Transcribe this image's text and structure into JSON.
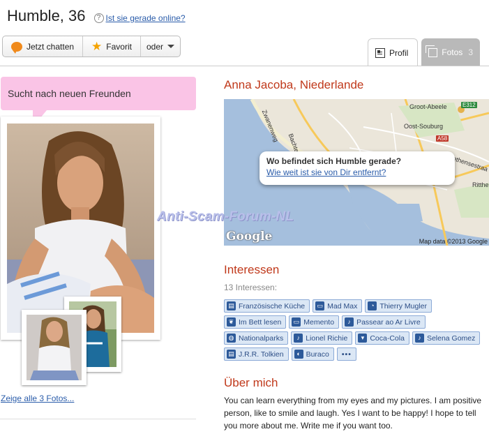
{
  "header": {
    "name_age": "Humble, 36",
    "help_icon": "question-icon",
    "online_link": "Ist sie gerade online?"
  },
  "actions": {
    "chat_label": "Jetzt chatten",
    "favorite_label": "Favorit",
    "more_label": "oder"
  },
  "tabs": [
    {
      "label": "Profil",
      "icon": "profile-doc-icon",
      "active": true
    },
    {
      "label": "Fotos",
      "count": "3",
      "icon": "photos-icon",
      "active": false
    }
  ],
  "status_bubble": "Sucht nach neuen Freunden",
  "show_all_photos": "Zeige alle 3 Fotos...",
  "location": "Anna Jacoba, Niederlande",
  "map": {
    "popup_question": "Wo befindet sich Humble gerade?",
    "popup_link": "Wie weit ist sie von Dir entfernt?",
    "labels": [
      "Groot-Abeele",
      "Oost-Souburg",
      "Ritthe",
      "Zwanenweg",
      "Bachten",
      "ethensestraa"
    ],
    "road_signs": [
      "E312",
      "A58"
    ],
    "logo": "Google",
    "copyright": "Map data ©2013 Google"
  },
  "watermark": "Anti-Scam-Forum-NL",
  "interests": {
    "title": "Interessen",
    "count_text": "13 Interessen:",
    "items": [
      {
        "label": "Französische Küche",
        "icon": "book-icon"
      },
      {
        "label": "Mad Max",
        "icon": "tv-icon"
      },
      {
        "label": "Thierry Mugler",
        "icon": "perfume-icon"
      },
      {
        "label": "Im Bett lesen",
        "icon": "leaf-icon"
      },
      {
        "label": "Memento",
        "icon": "tv-icon"
      },
      {
        "label": "Passear ao Ar Livre",
        "icon": "guitar-icon"
      },
      {
        "label": "Nationalparks",
        "icon": "globe-icon"
      },
      {
        "label": "Lionel Richie",
        "icon": "music-note-icon"
      },
      {
        "label": "Coca-Cola",
        "icon": "cup-icon"
      },
      {
        "label": "Selena Gomez",
        "icon": "music-note-icon"
      },
      {
        "label": "J.R.R. Tolkien",
        "icon": "book-icon"
      },
      {
        "label": "Buraco",
        "icon": "cards-icon"
      }
    ],
    "more_label": "•••"
  },
  "about": {
    "title": "Über mich",
    "text": "You can learn everything from my eyes and my pictures. I am positive person, like to smile and laugh. Yes I want to be happy! I hope to tell you more about me. Write me if you want too."
  },
  "colors": {
    "accent": "#c0391b",
    "link": "#2a5caa",
    "bubble": "#fac4e6",
    "tag_bg": "#dbe7f5"
  }
}
